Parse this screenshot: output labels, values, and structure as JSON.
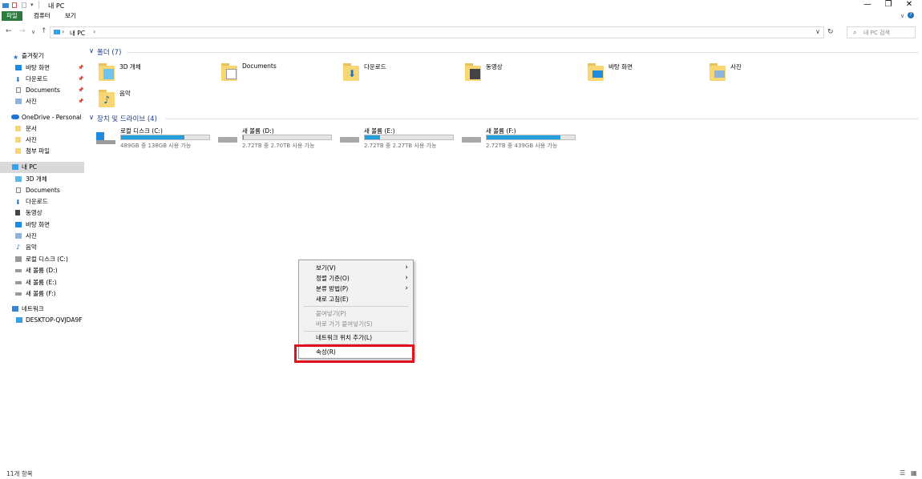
{
  "window": {
    "title": "내 PC",
    "controls": {
      "minimize": "—",
      "maximize": "❐",
      "close": "✕"
    }
  },
  "ribbon": {
    "tabs": [
      "파일",
      "컴퓨터",
      "보기"
    ]
  },
  "nav": {
    "address_root": "내 PC",
    "search_placeholder": "내 PC 검색"
  },
  "sidebar": {
    "quick_access": {
      "label": "즐겨찾기",
      "items": [
        "바탕 화면",
        "다운로드",
        "Documents",
        "사진"
      ]
    },
    "onedrive": {
      "label": "OneDrive - Personal",
      "items": [
        "문서",
        "사진",
        "첨부 파일"
      ]
    },
    "this_pc": {
      "label": "내 PC",
      "items": [
        "3D 개체",
        "Documents",
        "다운로드",
        "동영상",
        "바탕 화면",
        "사진",
        "음악",
        "로컬 디스크 (C:)",
        "새 볼륨 (D:)",
        "새 볼륨 (E:)",
        "새 볼륨 (F:)"
      ]
    },
    "network": {
      "label": "네트워크",
      "items": [
        "DESKTOP-QVJDA9F"
      ]
    }
  },
  "folders_section": {
    "title": "폴더 (7)",
    "items": [
      "3D 개체",
      "Documents",
      "다운로드",
      "동영상",
      "바탕 화면",
      "사진",
      "음악"
    ]
  },
  "drives_section": {
    "title": "장치 및 드라이브 (4)",
    "items": [
      {
        "name": "로컬 디스크 (C:)",
        "size_text": "489GB 중 138GB 사용 가능",
        "used_fraction": 0.72
      },
      {
        "name": "새 볼륨 (D:)",
        "size_text": "2.72TB 중 2.70TB 사용 가능",
        "used_fraction": 0.01
      },
      {
        "name": "새 볼륨 (E:)",
        "size_text": "2.72TB 중 2.27TB 사용 가능",
        "used_fraction": 0.17
      },
      {
        "name": "새 볼륨 (F:)",
        "size_text": "2.72TB 중 439GB 사용 가능",
        "used_fraction": 0.84
      }
    ]
  },
  "context_menu": {
    "items": [
      "보기(V)",
      "정렬 기준(O)",
      "분류 방법(P)",
      "새로 고침(E)",
      "붙여넣기(P)",
      "바로 가기 붙여넣기(S)",
      "네트워크 위치 추가(L)",
      "속성(R)"
    ]
  },
  "status": {
    "text": "11개 항목"
  },
  "colors": {
    "accent": "#26a0da",
    "file_tab": "#2b7a3e",
    "highlight": "#e0101e",
    "folder": "#f7d774"
  }
}
